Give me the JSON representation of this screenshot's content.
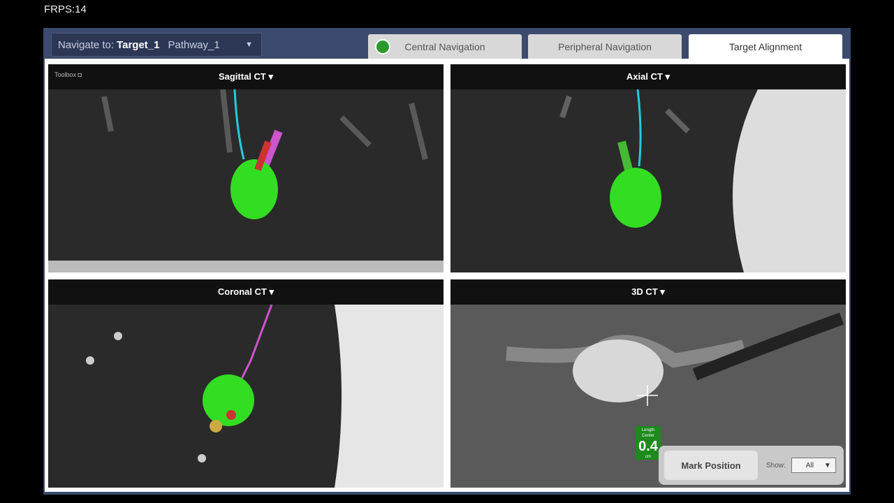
{
  "fps": "FRPS:14",
  "navigate": {
    "label": "Navigate to:",
    "target": "Target_1",
    "pathway": "Pathway_1"
  },
  "tabs": [
    {
      "label": "Central Navigation",
      "icon": "lung-icon"
    },
    {
      "label": "Peripheral Navigation"
    },
    {
      "label": "Target Alignment",
      "active": true
    }
  ],
  "panels": {
    "toolbox": "Toolbox",
    "sagittal": "Sagittal CT ▾",
    "axial": "Axial CT ▾",
    "coronal": "Coronal CT ▾",
    "ct3d": "3D CT ▾"
  },
  "badge": {
    "top": "Length",
    "mid": "Center",
    "value": "0.4",
    "unit": "cm"
  },
  "mark_position": "Mark Position",
  "show": {
    "label": "Show:",
    "value": "All"
  },
  "colors": {
    "target": "#33dd22",
    "catheter": "#22ccdd",
    "pathway": "#cc55cc"
  }
}
